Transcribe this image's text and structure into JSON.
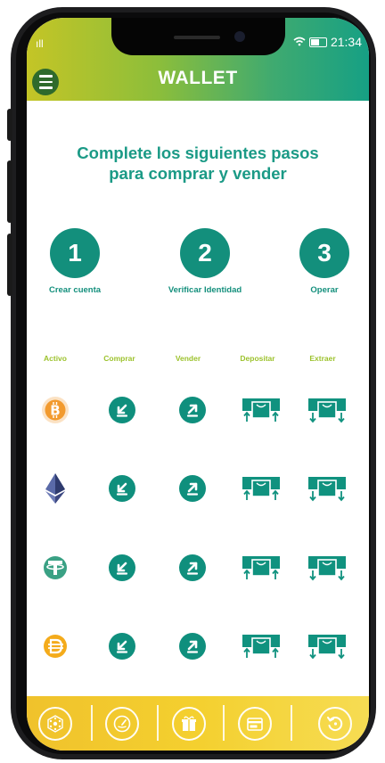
{
  "status": {
    "time": "21:34",
    "signal": "ıll"
  },
  "header": {
    "title": "WALLET",
    "menu_icon": "hamburger-icon"
  },
  "intro": {
    "line1": "Complete los siguientes pasos",
    "line2": "para comprar y vender"
  },
  "steps": [
    {
      "number": "1",
      "label": "Crear cuenta"
    },
    {
      "number": "2",
      "label": "Verificar Identidad"
    },
    {
      "number": "3",
      "label": "Operar"
    }
  ],
  "table": {
    "columns": [
      "Activo",
      "Comprar",
      "Vender",
      "Depositar",
      "Extraer"
    ],
    "assets": [
      {
        "icon": "bitcoin-icon",
        "color": "#f29a2e"
      },
      {
        "icon": "ethereum-icon",
        "color": "#4f5d93"
      },
      {
        "icon": "tether-icon",
        "color": "#3aa184"
      },
      {
        "icon": "dai-icon",
        "color": "#f4ab1b"
      }
    ],
    "actions": [
      "buy-arrow-icon",
      "sell-arrow-icon",
      "deposit-icon",
      "withdraw-icon"
    ]
  },
  "bottom_nav": [
    "network-icon",
    "speedometer-icon",
    "gift-box-icon",
    "wallet-card-icon",
    "history-icon"
  ],
  "colors": {
    "primary": "#138f7c",
    "accent": "#9cc22c",
    "footer": "#f4d02f"
  }
}
